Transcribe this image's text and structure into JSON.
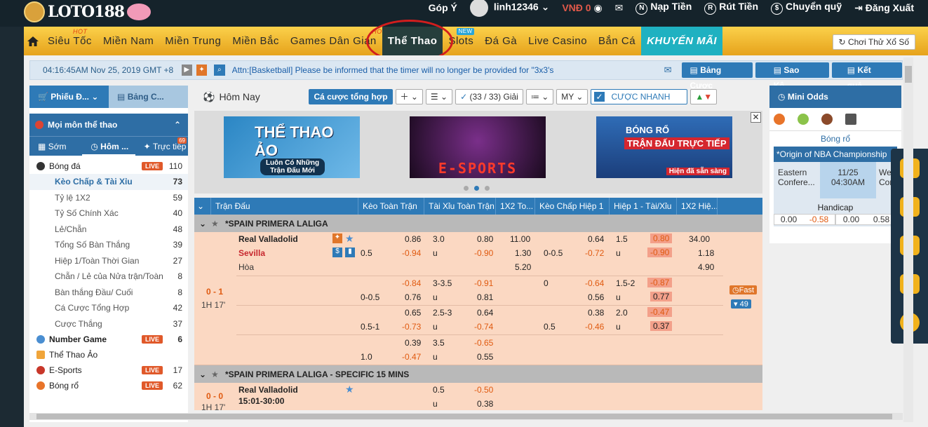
{
  "topbar": {
    "logo": "LOTO188",
    "feedback": "Góp Ý",
    "username": "linh12346",
    "balance": "VNĐ 0",
    "deposit": "Nạp Tiền",
    "withdraw": "Rút Tiền",
    "transfer": "Chuyển quỹ",
    "logout": "Đăng Xuất"
  },
  "nav": {
    "items": [
      "Siêu Tốc",
      "Miền Nam",
      "Miền Trung",
      "Miền Bắc",
      "Games Dân Gian",
      "Thể Thao",
      "Slots",
      "Đá Gà",
      "Live Casino",
      "Bắn Cá",
      "KHUYẾN MÃI"
    ],
    "hot": "HOT",
    "new": "NEW",
    "try_lotto": "Chơi Thử Xổ Số"
  },
  "infobar": {
    "clock": "04:16:45AM Nov 25, 2019 GMT +8",
    "ticker": "Attn:[Basketball] Please be informed that the timer will no longer be provided for \"3x3's",
    "btn_bet_table": "Bảng Cược",
    "btn_statement": "Sao Kê",
    "btn_results": "Kết quả"
  },
  "left": {
    "tab1": "Phiếu Đ...",
    "tab2": "Bảng C...",
    "all_sports": "Mọi môn thể thao",
    "time_tabs": [
      "Sớm",
      "Hôm ...",
      "Trực tiếp"
    ],
    "live_badge_count": "69",
    "live_label": "LIVE",
    "sports": [
      {
        "name": "Bóng đá",
        "count": "110",
        "live": true
      },
      {
        "name": "Number Game",
        "count": "6",
        "live": true
      },
      {
        "name": "Thể Thao Ảo",
        "count": "",
        "live": false
      },
      {
        "name": "E-Sports",
        "count": "17",
        "live": true
      },
      {
        "name": "Bóng rổ",
        "count": "62",
        "live": true
      }
    ],
    "subs": [
      {
        "name": "Kèo Chấp & Tài Xỉu",
        "count": "73"
      },
      {
        "name": "Tỷ lệ 1X2",
        "count": "59"
      },
      {
        "name": "Tỷ Số Chính Xác",
        "count": "40"
      },
      {
        "name": "Lẻ/Chẵn",
        "count": "48"
      },
      {
        "name": "Tổng Số Bàn Thắng",
        "count": "39"
      },
      {
        "name": "Hiệp 1/Toàn Thời Gian",
        "count": "27"
      },
      {
        "name": "Chẵn / Lẻ của Nửa trận/Toàn",
        "count": "8"
      },
      {
        "name": "Bàn thắng Đầu/ Cuối",
        "count": "8"
      },
      {
        "name": "Cá Cược Tổng Hợp",
        "count": "42"
      },
      {
        "name": "Cược Thắng",
        "count": "37"
      }
    ]
  },
  "center": {
    "today": "Hôm Nay",
    "combo": "Cá cược tổng hợp",
    "leagues_btn": "(33 / 33) Giải",
    "odds_type": "MY",
    "quick_bet": "CƯỢC NHANH",
    "banners": {
      "virtual_title": "THỂ THAO ẢO",
      "virtual_sub": "Luôn Có Những Trận Đấu Mới",
      "esports": "E-SPORTS",
      "basket_title": "BÓNG RỔ",
      "basket_sub": "TRẬN ĐẤU TRỰC TIẾP",
      "basket_foot": "Hiện đã sẵn sàng"
    },
    "headers": [
      "Trận Đấu",
      "Kèo Toàn Trận",
      "Tài Xỉu Toàn Trận",
      "1X2 To...",
      "Kèo Chấp Hiệp 1",
      "Hiệp 1 - Tài/Xỉu",
      "1X2 Hiệ..."
    ],
    "league1": "*SPAIN PRIMERA LALIGA",
    "league2": "*SPAIN PRIMERA LALIGA - SPECIFIC 15 MINS",
    "match1": {
      "score": "0 - 1",
      "time": "1H 17'",
      "home": "Real Valladolid",
      "away": "Sevilla",
      "draw": "Hòa",
      "fast": "Fast",
      "more": "▾ 49"
    },
    "match2": {
      "score": "0 - 0",
      "time": "1H 17'",
      "home": "Real Valladolid",
      "period": "15:01-30:00",
      "ou": "0.5",
      "u": "u",
      "o1": "-0.50",
      "o2": "0.38"
    },
    "rows": [
      {
        "hdp": "0.5",
        "h1": "0.86",
        "h2": "-0.94",
        "ou": "3.0",
        "u": "u",
        "o1": "0.80",
        "o2": "-0.90",
        "x1": "11.00",
        "x2": "1.30",
        "x3": "5.20",
        "fhdp": "0-0.5",
        "f1": "0.64",
        "f2": "-0.72",
        "fou": "1.5",
        "fu": "u",
        "fo1": "0.80",
        "fo2": "-0.90",
        "fx1": "34.00",
        "fx2": "1.18",
        "fx3": "4.90"
      },
      {
        "hdp": "0-0.5",
        "h1": "-0.84",
        "h2": "0.76",
        "ou": "3-3.5",
        "u": "u",
        "o1": "-0.91",
        "o2": "0.81",
        "fhdp": "0",
        "f1": "-0.64",
        "f2": "0.56",
        "fou": "1.5-2",
        "fu": "u",
        "fo1": "-0.87",
        "fo2": "0.77"
      },
      {
        "hdp": "0.5-1",
        "h1": "0.65",
        "h2": "-0.73",
        "ou": "2.5-3",
        "u": "u",
        "o1": "0.64",
        "o2": "-0.74",
        "fhdp": "0.5",
        "f1": "0.38",
        "f2": "-0.46",
        "fou": "2.0",
        "fu": "u",
        "fo1": "-0.47",
        "fo2": "0.37"
      },
      {
        "hdp": "1.0",
        "h1": "0.39",
        "h2": "-0.47",
        "ou": "3.5",
        "u": "u",
        "o1": "-0.65",
        "o2": "0.55"
      }
    ]
  },
  "right": {
    "title": "Mini Odds",
    "sport": "Bóng rổ",
    "league": "*Origin of NBA Championship",
    "home": "Eastern Confere...",
    "away": "We... Con...",
    "date": "11/25",
    "time": "04:30AM",
    "market": "Handicap",
    "v1": "0.00",
    "v2": "-0.58",
    "v3": "0.00",
    "v4": "0.58"
  }
}
